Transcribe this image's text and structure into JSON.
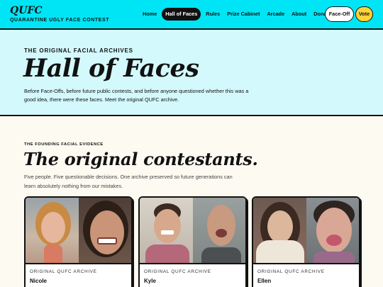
{
  "header": {
    "logo": "QUFC",
    "tagline": "QUARANTINE UGLY FACE CONTEST",
    "nav": [
      "Home",
      "Hall of Faces",
      "Rules",
      "Prize Cabinet",
      "Arcade",
      "About",
      "Donate"
    ],
    "active_nav": "Hall of Faces",
    "faceoff_label": "Face-Off",
    "vote_label": "Vote"
  },
  "hero": {
    "eyebrow": "THE ORIGINAL FACIAL ARCHIVES",
    "title": "Hall of Faces",
    "description": "Before Face-Offs, before future public contests, and before anyone questioned whether this was a good idea, there were these faces. Meet the original QUFC archive."
  },
  "section": {
    "eyebrow": "THE FOUNDING FACIAL EVIDENCE",
    "title": "The original contestants.",
    "description": "Five people. Five questionable decisions. One archive preserved so future generations can learn absolutely nothing from our mistakes."
  },
  "cards": [
    {
      "eyebrow": "ORIGINAL QUFC ARCHIVE",
      "name": "Nicole"
    },
    {
      "eyebrow": "ORIGINAL QUFC ARCHIVE",
      "name": "Kyle"
    },
    {
      "eyebrow": "ORIGINAL QUFC ARCHIVE",
      "name": "Ellen"
    }
  ],
  "colors": {
    "topbar": "#00e5f5",
    "hero_bg": "#d4f9fd",
    "page_bg": "#fdfaf1",
    "vote": "#ffd23a",
    "ink": "#111111"
  }
}
